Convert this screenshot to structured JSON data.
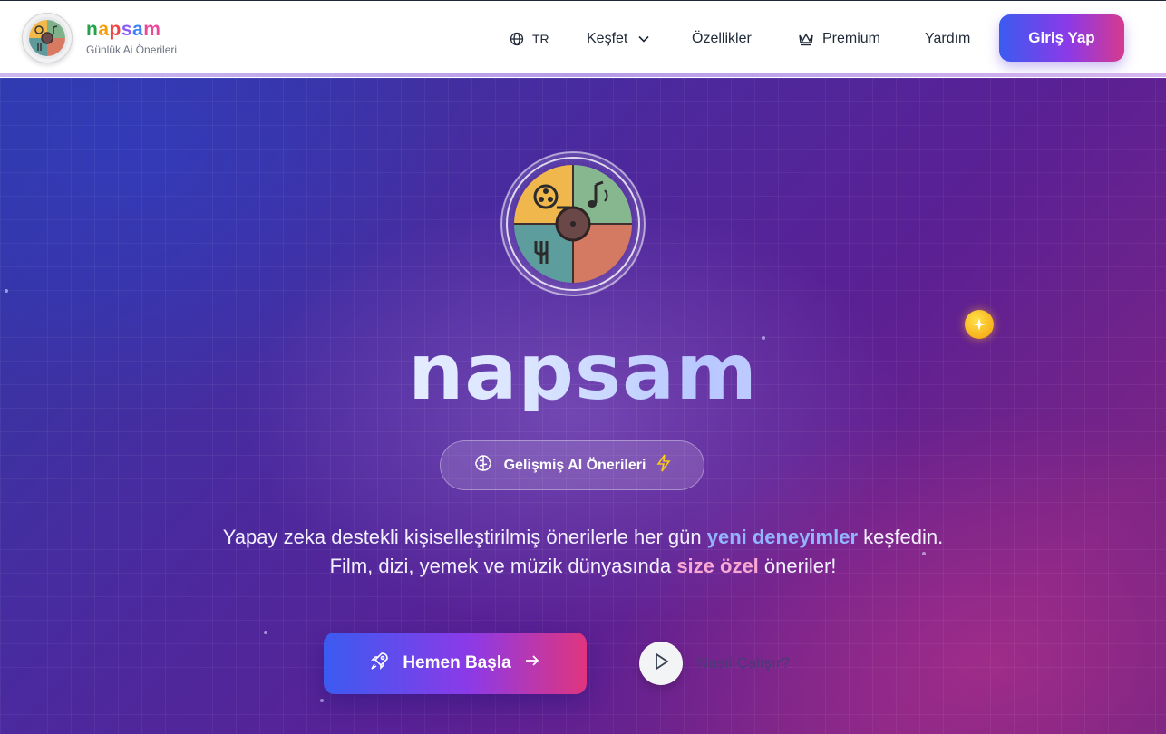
{
  "header": {
    "brand_name": [
      "n",
      "a",
      "p",
      "s",
      "a",
      "m"
    ],
    "brand_subtitle": "Günlük Ai Önerileri",
    "nav": {
      "language": "TR",
      "explore": "Keşfet",
      "features": "Özellikler",
      "premium": "Premium",
      "help": "Yardım"
    },
    "login_label": "Giriş Yap"
  },
  "hero": {
    "title": "napsam",
    "badge_label": "Gelişmiş AI Önerileri",
    "tagline_line1_part1": "Yapay zeka destekli kişiselleştirilmiş önerilerle her gün ",
    "tagline_line1_highlight": "yeni deneyimler",
    "tagline_line1_part2": " keşfedin.",
    "tagline_line2_part1": "Film, dizi, yemek ve müzik dünyasında ",
    "tagline_line2_highlight": "size özel",
    "tagline_line2_part2": " öneriler!",
    "cta_label": "Hemen Başla",
    "how_label": "Nasıl Çalışır?"
  },
  "colors": {
    "accent_blue": "#3b5bf0",
    "accent_purple": "#8b3ae8",
    "accent_pink": "#e0357e",
    "highlight_blue": "#93b4ff",
    "highlight_pink": "#f9a8d4"
  },
  "icons": {
    "logo": "brain-quadrant-logo",
    "language": "globe-icon",
    "explore_chevron": "chevron-down-icon",
    "premium": "crown-icon",
    "badge_left": "brain-icon",
    "badge_right": "lightning-icon",
    "sparkle": "sparkles-icon",
    "cta_left": "rocket-icon",
    "cta_right": "arrow-right-icon",
    "play": "play-icon"
  }
}
